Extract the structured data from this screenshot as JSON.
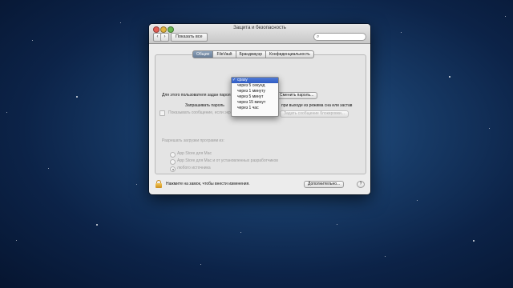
{
  "window": {
    "title": "Защита и безопасность",
    "show_all_label": "Показать все",
    "search_placeholder": ""
  },
  "tabs": [
    "Общие",
    "FileVault",
    "Брандмауэр",
    "Конфиденциальность"
  ],
  "general": {
    "password_set_text": "Для этого пользователя задан пароль для входа",
    "change_password_button": "Сменить пароль...",
    "require_password_label": "Запрашивать пароль",
    "require_password_suffix": "при выходе из режима сна или застав",
    "show_message_label": "Показывать сообщение, если экран заблокирован",
    "set_lock_message_button": "Задать сообщение блокировки..."
  },
  "delay_dropdown": {
    "options": [
      "сразу",
      "через 5 секунд",
      "через 1 минуту",
      "через 5 минут",
      "через 15 минут",
      "через 1 час"
    ],
    "selected": "сразу"
  },
  "downloads": {
    "label": "Разрешать загрузки программ из:",
    "options": [
      "App Store для Mac",
      "App Store для Mac и от установленных разработчиков",
      "любого источника"
    ],
    "selected_index": 2
  },
  "footer": {
    "lock_text": "Нажмите на замок, чтобы внести изменения.",
    "advanced_button": "Дополнительно...",
    "help_button": "?"
  }
}
